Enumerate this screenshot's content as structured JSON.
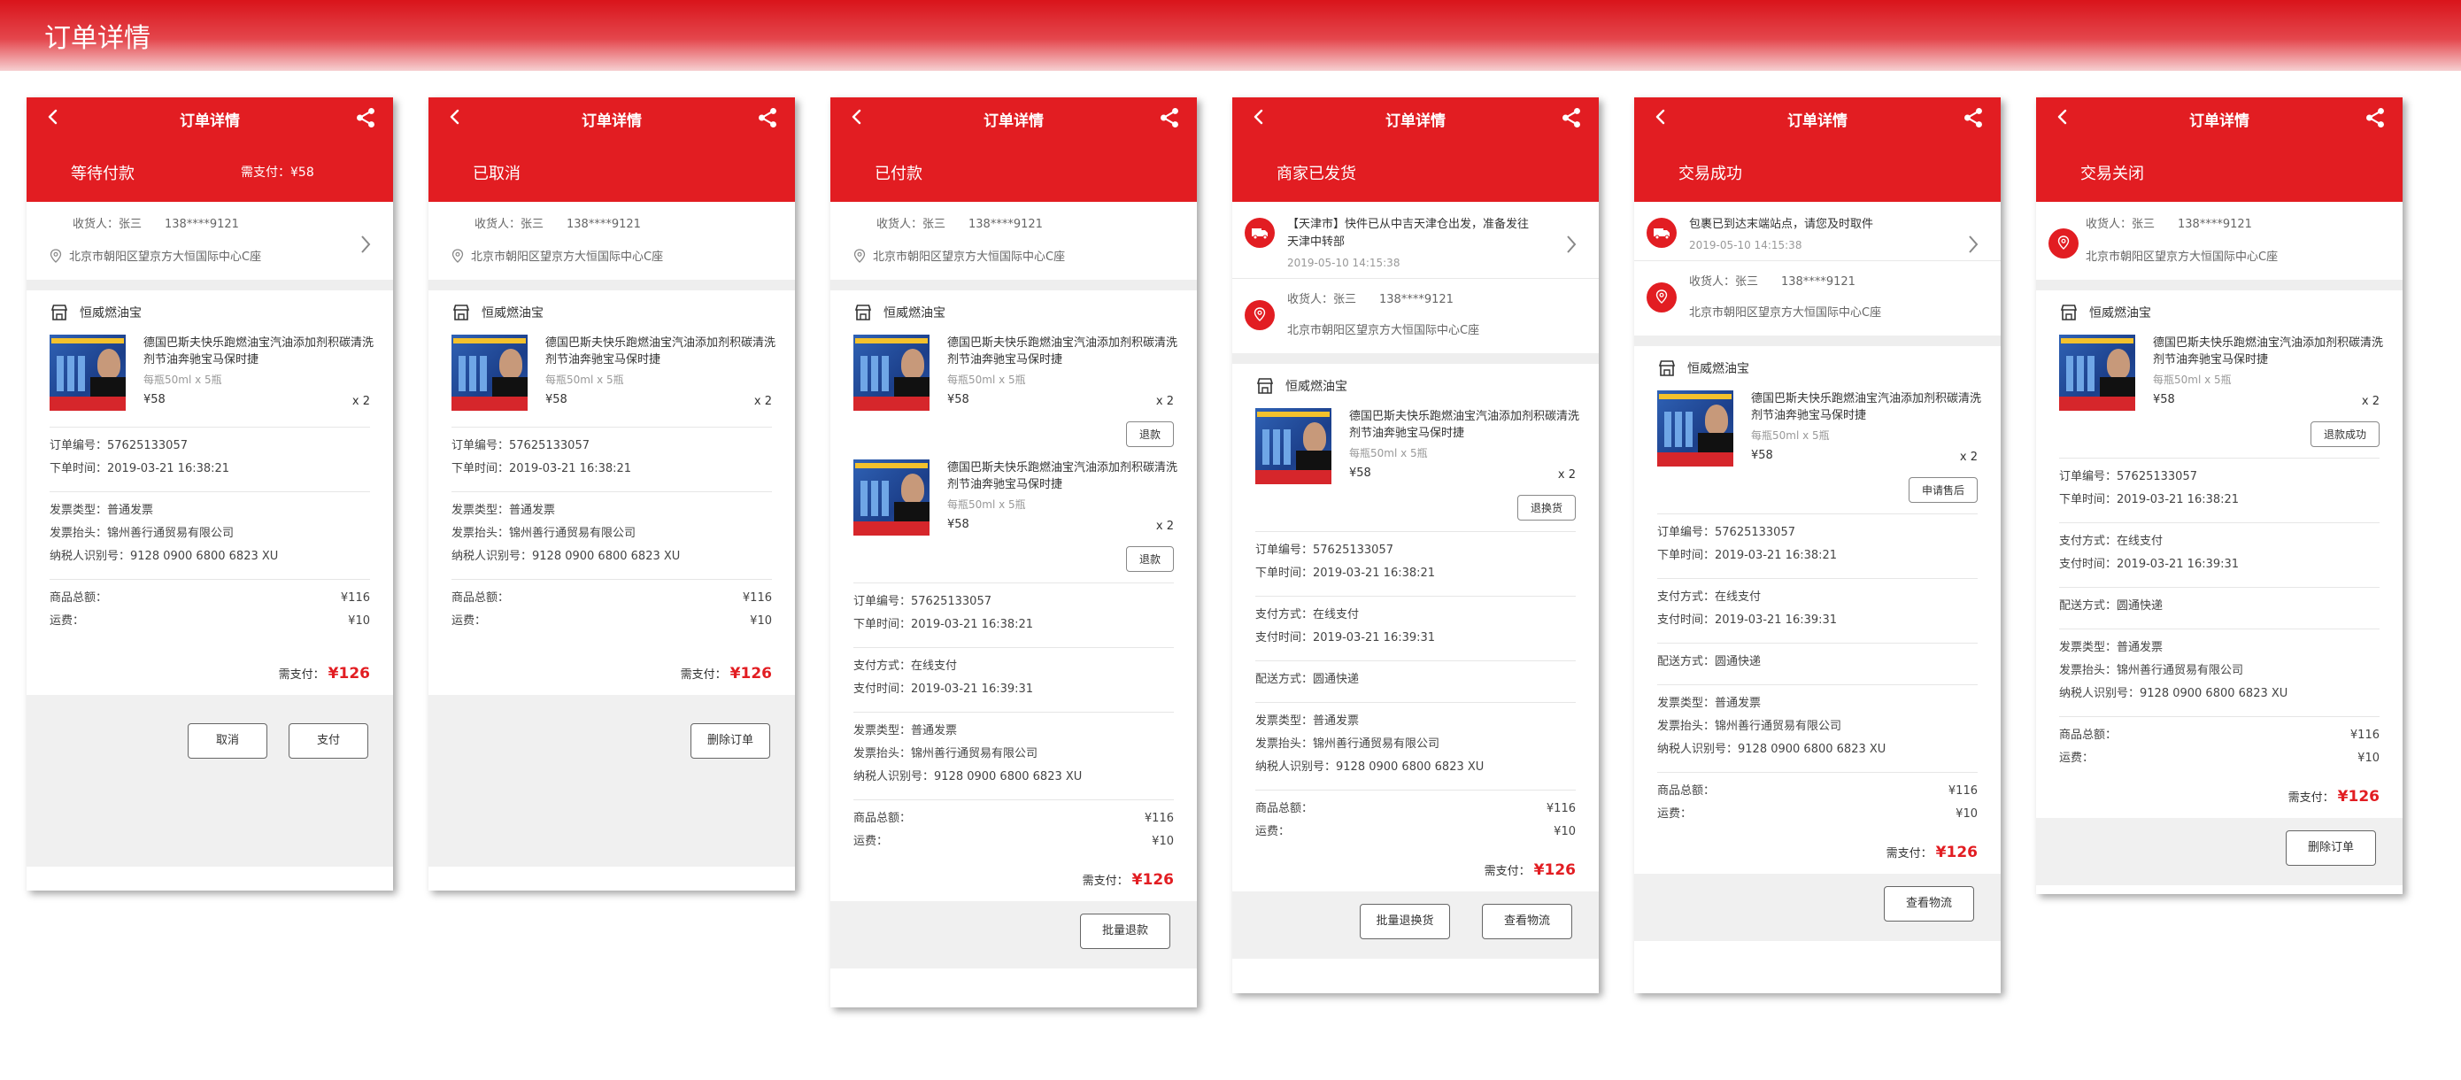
{
  "page": {
    "title": "订单详情"
  },
  "common": {
    "nav_title": "订单详情",
    "receiver_label": "收货人：张三",
    "phone": "138****9121",
    "address": "北京市朝阳区望京方大恒国际中心C座",
    "shop_name": "恒威燃油宝",
    "product_name": "德国巴斯夫快乐跑燃油宝汽油添加剂积碳清洗剂节油奔驰宝马保时捷",
    "product_spec": "每瓶50ml x 5瓶",
    "product_price": "¥58",
    "product_qty": "x 2",
    "order_no": "订单编号：57625133057",
    "order_time": "下单时间：2019-03-21 16:38:21",
    "pay_method": "支付方式：在线支付",
    "pay_time": "支付时间：2019-03-21 16:39:31",
    "delivery": "配送方式：圆通快递",
    "invoice_type": "发票类型：普通发票",
    "invoice_title": "发票抬头：锦州善行通贸易有限公司",
    "tax_id": "纳税人识别号：9128 0900 6800 6823 XU",
    "goods_total_label": "商品总额：",
    "goods_total_value": "¥116",
    "shipping_label": "运费：",
    "shipping_value": "¥10",
    "need_pay_label": "需支付：",
    "need_pay_value": "¥126"
  },
  "cards": [
    {
      "status": "等待付款",
      "header_need": "需支付：¥58",
      "buttons": [
        "取消",
        "支付"
      ]
    },
    {
      "status": "已取消",
      "buttons": [
        "删除订单"
      ]
    },
    {
      "status": "已付款",
      "item_button": "退款",
      "buttons": [
        "批量退款"
      ]
    },
    {
      "status": "商家已发货",
      "logistics_text": "【天津市】快件已从中吉天津仓出发，准备发往天津中转部",
      "logistics_time": "2019-05-10 14:15:38",
      "item_button": "退换货",
      "buttons": [
        "批量退换货",
        "查看物流"
      ]
    },
    {
      "status": "交易成功",
      "logistics_text": "包裹已到达末端站点，请您及时取件",
      "logistics_time": "2019-05-10 14:15:38",
      "item_button": "申请售后",
      "buttons": [
        "查看物流"
      ]
    },
    {
      "status": "交易关闭",
      "item_button": "退款成功",
      "buttons": [
        "删除订单"
      ]
    }
  ]
}
